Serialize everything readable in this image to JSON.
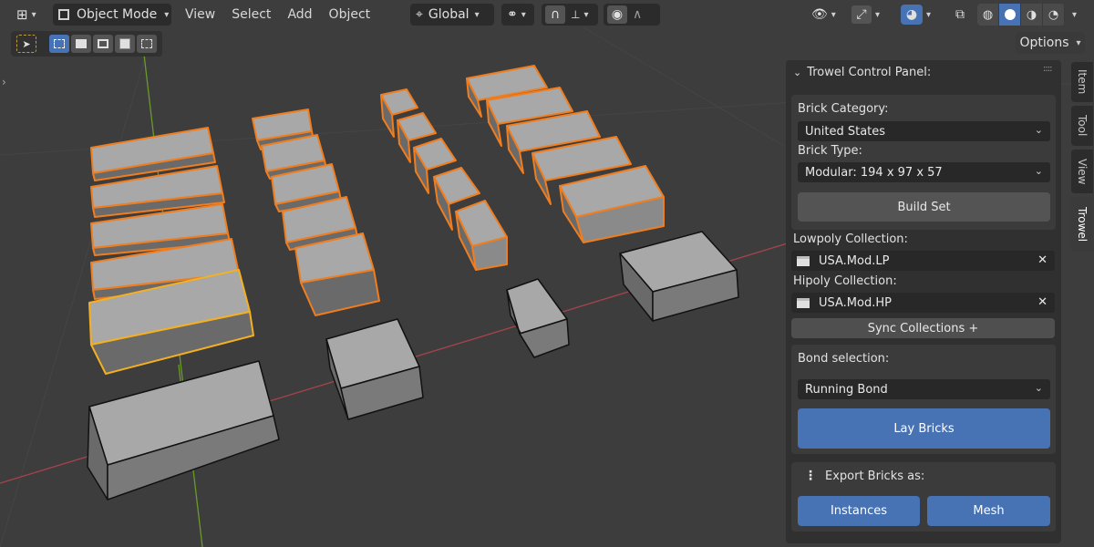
{
  "header": {
    "mode": "Object Mode",
    "menus": [
      "View",
      "Select",
      "Add",
      "Object"
    ],
    "orientation": "Global"
  },
  "toolbar": {
    "options_label": "Options"
  },
  "panel": {
    "title": "Trowel Control Panel:",
    "brick_category_label": "Brick Category:",
    "brick_category_value": "United States",
    "brick_type_label": "Brick Type:",
    "brick_type_value": "Modular: 194 x 97 x 57",
    "build_set_label": "Build Set",
    "lowpoly_label": "Lowpoly Collection:",
    "lowpoly_value": "USA.Mod.LP",
    "hipoly_label": "Hipoly Collection:",
    "hipoly_value": "USA.Mod.HP",
    "sync_label": "Sync Collections +",
    "bond_label": "Bond selection:",
    "bond_value": "Running Bond",
    "lay_bricks_label": "Lay Bricks",
    "export_label": "Export Bricks as:",
    "instances_label": "Instances",
    "mesh_label": "Mesh"
  },
  "tabs": [
    "Item",
    "Tool",
    "View",
    "Trowel"
  ],
  "colors": {
    "accent": "#4772b3",
    "selection": "#f07d1e",
    "active_selection": "#f5b020",
    "x_axis": "#b5434f",
    "y_axis": "#6a9a2a"
  }
}
